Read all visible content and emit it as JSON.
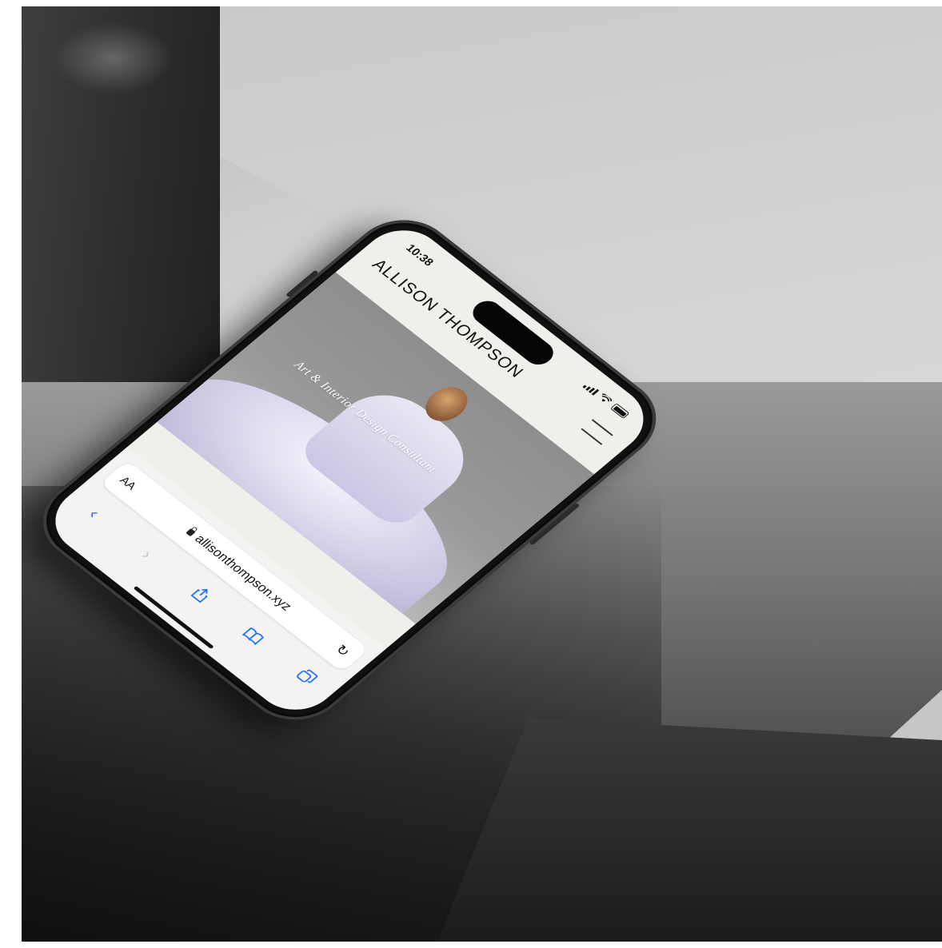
{
  "status_bar": {
    "time": "10:38"
  },
  "site": {
    "name": "ALLISON THOMPSON",
    "tagline": "Art & Interior Design Consultant"
  },
  "browser": {
    "text_size_label": "AA",
    "url": "allisonthompson.xyz",
    "reload_icon": "reload-icon",
    "nav_icons": [
      "back-icon",
      "forward-icon",
      "share-icon",
      "bookmarks-icon",
      "tabs-icon"
    ]
  },
  "colors": {
    "accent": "#1a6cff",
    "page_bg": "#f1efec"
  }
}
